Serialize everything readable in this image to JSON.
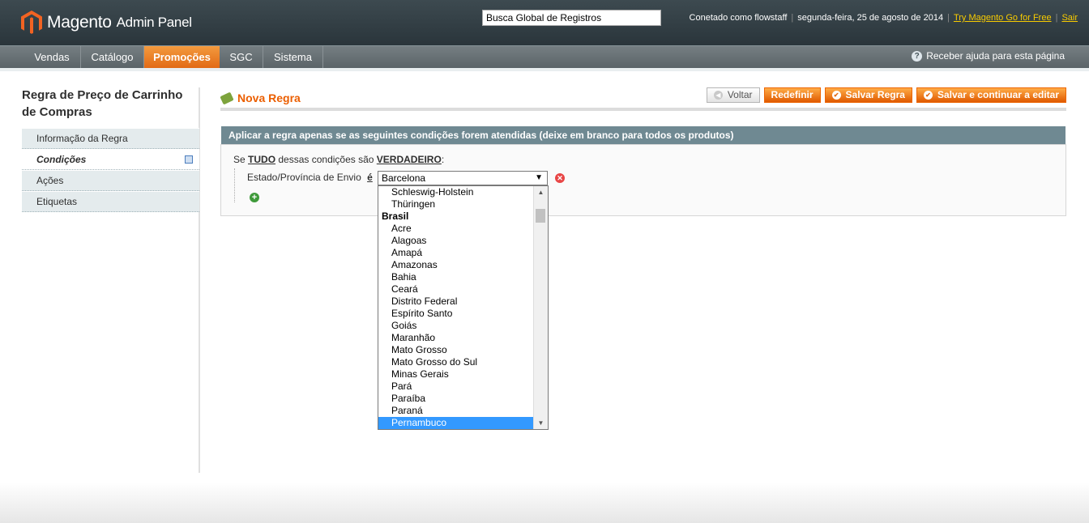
{
  "header": {
    "logo_brand": "Magento",
    "logo_suffix": "Admin Panel",
    "search_value": "Busca Global de Registros",
    "user": "Conetado como flowstaff",
    "date": "segunda-feira, 25 de agosto de 2014",
    "try_link": "Try Magento Go for Free",
    "logout": "Sair"
  },
  "nav": {
    "items": [
      {
        "label": "Vendas"
      },
      {
        "label": "Catálogo"
      },
      {
        "label": "Promoções"
      },
      {
        "label": "SGC"
      },
      {
        "label": "Sistema"
      }
    ],
    "help": "Receber ajuda para esta página"
  },
  "sidebar": {
    "title": "Regra de Preço de Carrinho de Compras",
    "tabs": [
      {
        "label": "Informação da Regra"
      },
      {
        "label": "Condições"
      },
      {
        "label": "Ações"
      },
      {
        "label": "Etiquetas"
      }
    ]
  },
  "main": {
    "title": "Nova Regra",
    "buttons": {
      "back": "Voltar",
      "reset": "Redefinir",
      "save": "Salvar Regra",
      "save_continue": "Salvar e continuar a editar"
    },
    "fieldset_title": "Aplicar a regra apenas se as seguintes condições forem atendidas (deixe em branco para todos os produtos)",
    "condition": {
      "prefix": "Se",
      "aggregator": "TUDO",
      "middle": "dessas condições são",
      "value": "VERDADEIRO",
      "suffix": ":",
      "attribute": "Estado/Província de Envio",
      "operator": "é",
      "selected": "Barcelona"
    },
    "dropdown_options": [
      {
        "label": "Schleswig-Holstein",
        "type": "option"
      },
      {
        "label": "Thüringen",
        "type": "option"
      },
      {
        "label": "Brasil",
        "type": "group"
      },
      {
        "label": "Acre",
        "type": "option"
      },
      {
        "label": "Alagoas",
        "type": "option"
      },
      {
        "label": "Amapá",
        "type": "option"
      },
      {
        "label": "Amazonas",
        "type": "option"
      },
      {
        "label": "Bahia",
        "type": "option"
      },
      {
        "label": "Ceará",
        "type": "option"
      },
      {
        "label": "Distrito Federal",
        "type": "option"
      },
      {
        "label": "Espírito Santo",
        "type": "option"
      },
      {
        "label": "Goiás",
        "type": "option"
      },
      {
        "label": "Maranhão",
        "type": "option"
      },
      {
        "label": "Mato Grosso",
        "type": "option"
      },
      {
        "label": "Mato Grosso do Sul",
        "type": "option"
      },
      {
        "label": "Minas Gerais",
        "type": "option"
      },
      {
        "label": "Pará",
        "type": "option"
      },
      {
        "label": "Paraíba",
        "type": "option"
      },
      {
        "label": "Paraná",
        "type": "option"
      },
      {
        "label": "Pernambuco",
        "type": "highlighted"
      }
    ]
  }
}
